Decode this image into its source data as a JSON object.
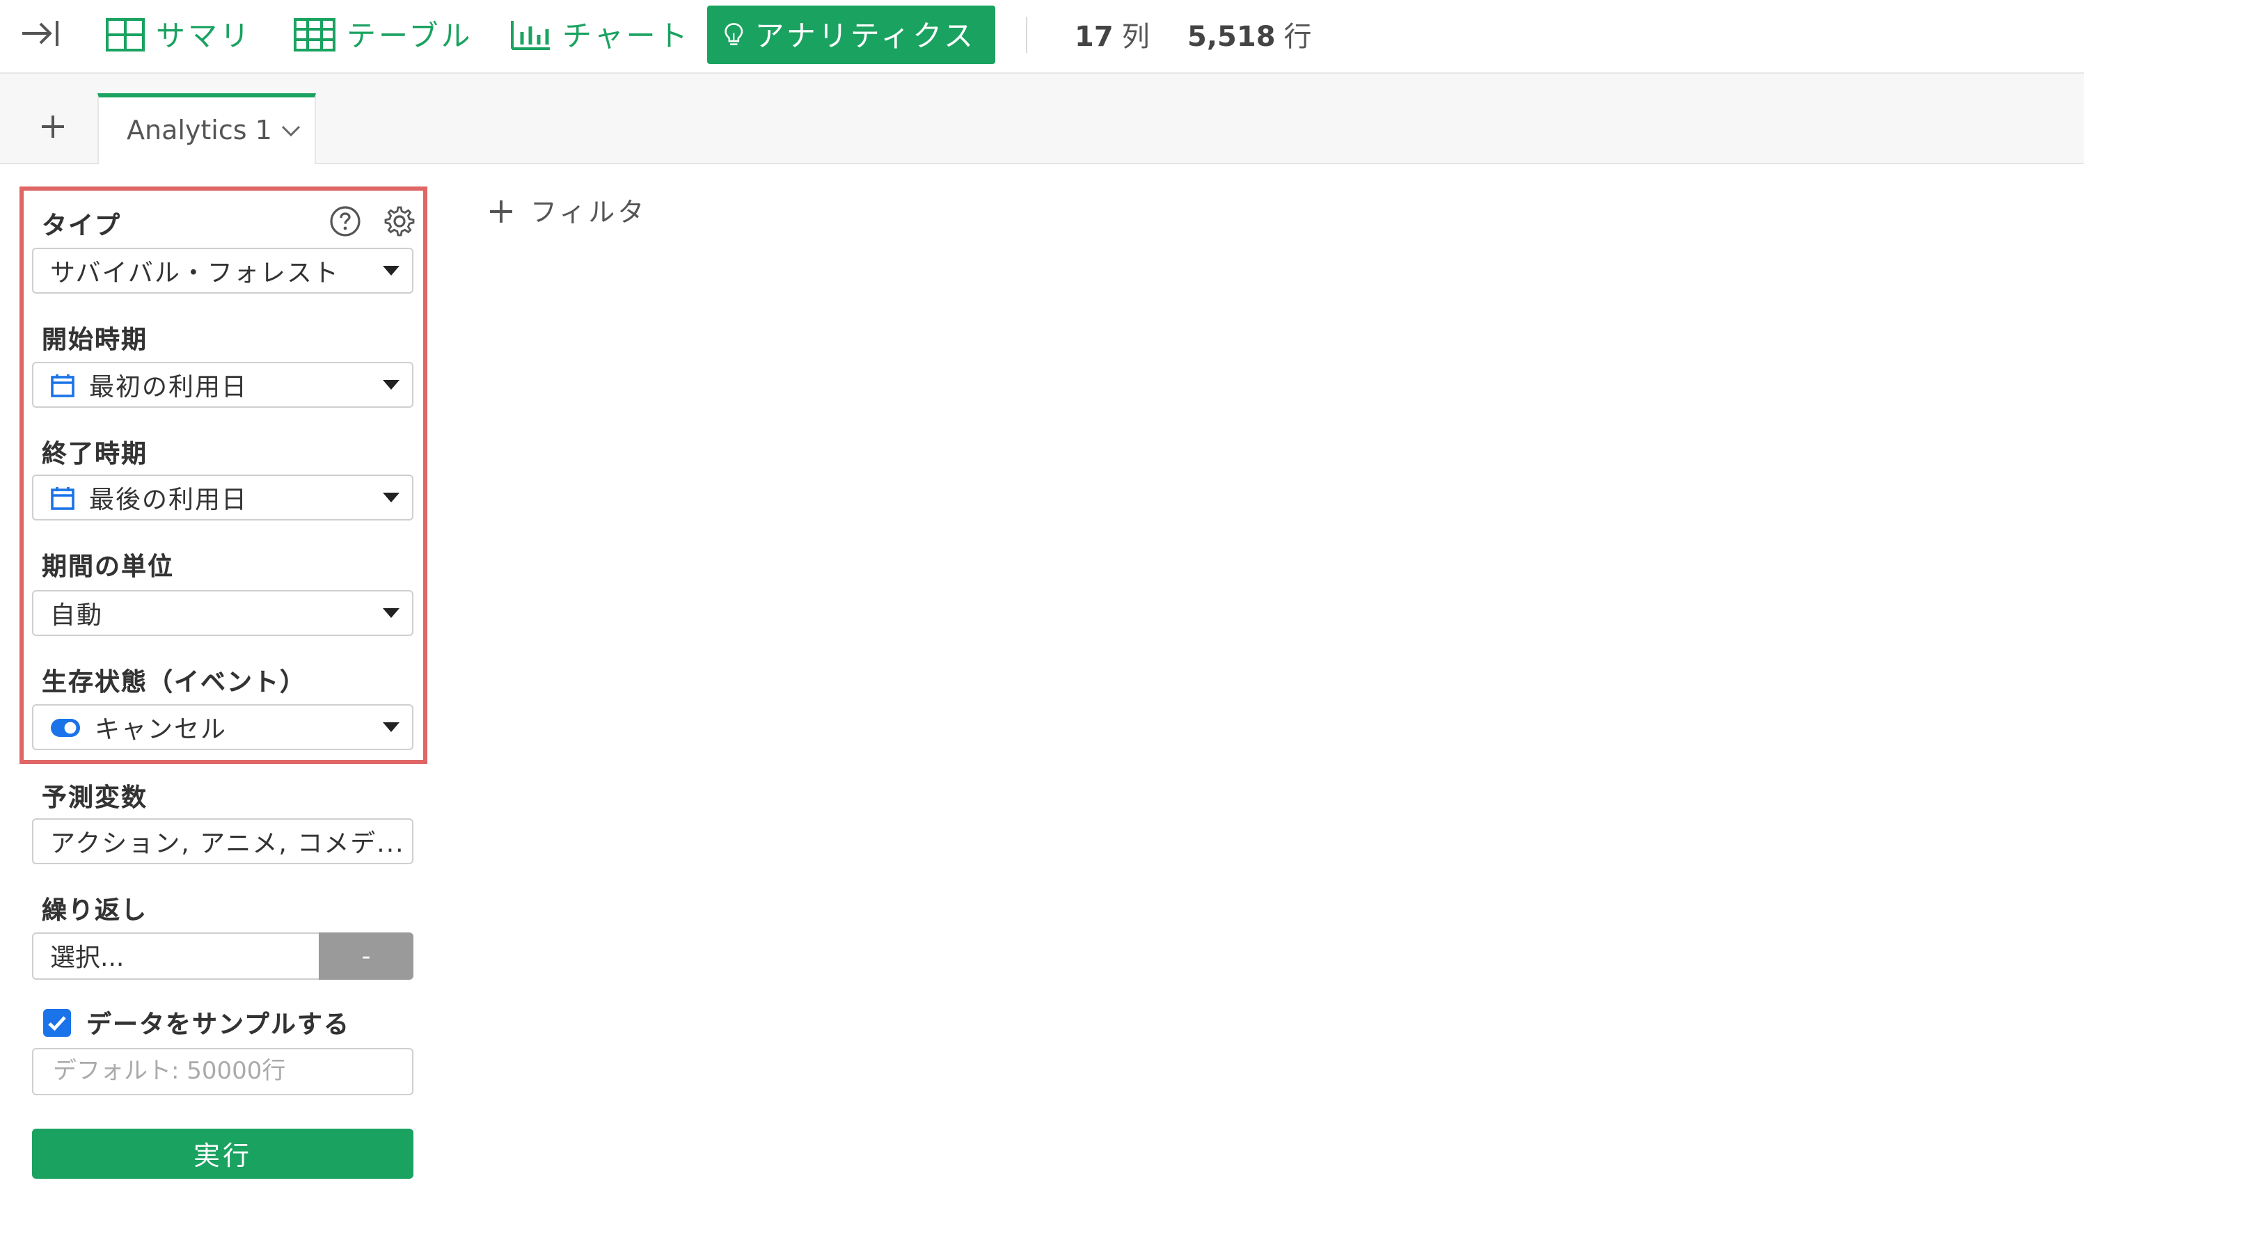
{
  "toolbar": {
    "nav": [
      {
        "label": "サマリ",
        "icon": "summary-grid-icon"
      },
      {
        "label": "テーブル",
        "icon": "table-icon"
      },
      {
        "label": "チャート",
        "icon": "bar-chart-icon"
      },
      {
        "label": "アナリティクス",
        "icon": "lightbulb-icon",
        "active": true
      }
    ],
    "columns": {
      "value": "17",
      "unit": "列"
    },
    "rows": {
      "value": "5,518",
      "unit": "行"
    }
  },
  "tabs": [
    {
      "label": "Analytics 1",
      "active": true
    }
  ],
  "filter": {
    "label": "フィルタ"
  },
  "panel": {
    "type": {
      "label": "タイプ",
      "value": "サバイバル・フォレスト"
    },
    "start": {
      "label": "開始時期",
      "value": "最初の利用日"
    },
    "end": {
      "label": "終了時期",
      "value": "最後の利用日"
    },
    "unit": {
      "label": "期間の単位",
      "value": "自動"
    },
    "status": {
      "label": "生存状態（イベント）",
      "value": "キャンセル"
    },
    "predictors": {
      "label": "予測変数",
      "value": "アクション, アニメ, コメデ..."
    },
    "repeat": {
      "label": "繰り返し",
      "value": "選択...",
      "button": "-"
    },
    "sample": {
      "label": "データをサンプルする",
      "checked": true,
      "placeholder": "デフォルト: 50000行"
    },
    "run_label": "実行"
  },
  "colors": {
    "accent": "#1aa260",
    "highlight": "#e06666",
    "checkbox": "#1a73e8"
  }
}
